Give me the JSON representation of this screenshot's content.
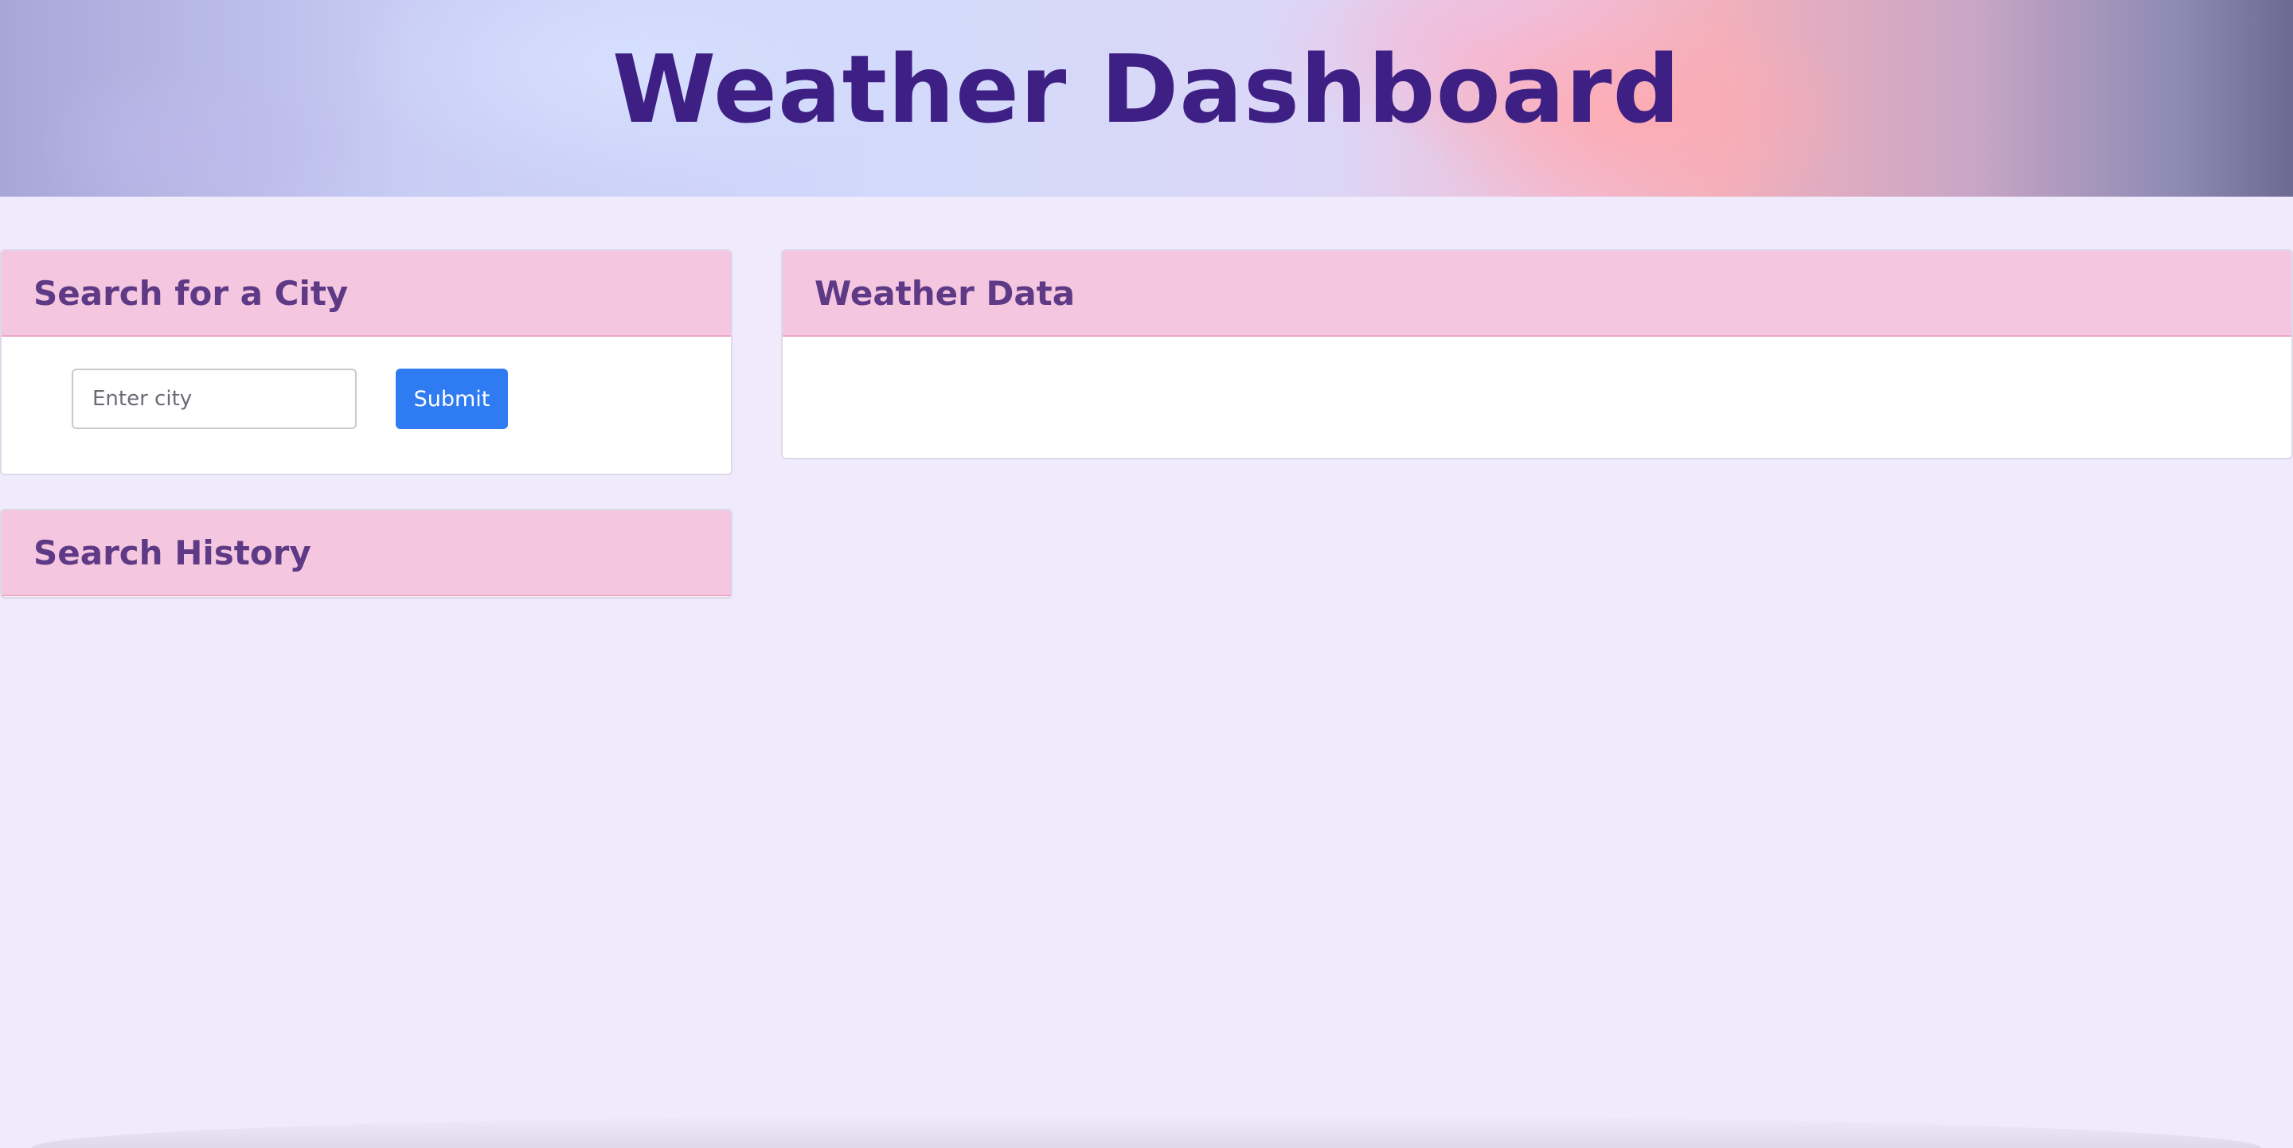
{
  "header": {
    "title": "Weather Dashboard"
  },
  "search": {
    "title": "Search for a City",
    "placeholder": "Enter city",
    "value": "",
    "submit_label": "Submit"
  },
  "history": {
    "title": "Search History",
    "items": []
  },
  "weather": {
    "title": "Weather Data"
  },
  "colors": {
    "background": "#efebfc",
    "title": "#3e2084",
    "card_header_bg": "#f4c6df",
    "card_header_text": "#5e3a86",
    "submit_button": "#2f7bf2"
  }
}
